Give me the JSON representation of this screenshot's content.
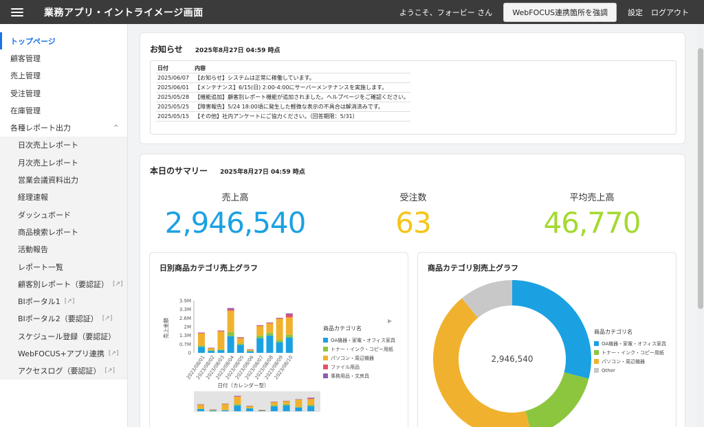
{
  "header": {
    "app_title": "業務アプリ・イントライメージ画面",
    "welcome": "ようこそ、フォービー さん",
    "webfocus_button": "WebFOCUS連携箇所を強調",
    "settings": "設定",
    "logout": "ログアウト"
  },
  "sidebar": {
    "items": [
      {
        "label": "トップページ"
      },
      {
        "label": "顧客管理"
      },
      {
        "label": "売上管理"
      },
      {
        "label": "受注管理"
      },
      {
        "label": "在庫管理"
      },
      {
        "label": "各種レポート出力",
        "chevron": "^"
      }
    ],
    "sub_items": [
      {
        "label": "日次売上レポート"
      },
      {
        "label": "月次売上レポート"
      },
      {
        "label": "営業会議資料出力"
      },
      {
        "label": "経理速報"
      },
      {
        "label": "ダッシュボード"
      },
      {
        "label": "商品検索レポート"
      },
      {
        "label": "活動報告"
      },
      {
        "label": "レポート一覧"
      },
      {
        "label": "顧客別レポート（要認証）",
        "ext": "[↗]"
      },
      {
        "label": "BIポータル1",
        "ext": "[↗]"
      },
      {
        "label": "BIポータル2（要認証）",
        "ext": "[↗]"
      },
      {
        "label": "スケジュール登録（要認証）"
      },
      {
        "label": "WebFOCUS+アプリ連携",
        "ext": "[↗]"
      },
      {
        "label": "アクセスログ（要認証）",
        "ext": "[↗]"
      }
    ]
  },
  "news": {
    "title": "お知らせ",
    "timestamp": "2025年8月27日 04:59 時点",
    "col_date": "日付",
    "col_content": "内容",
    "rows": [
      {
        "date": "2025/06/07",
        "text": "【お知らせ】システムは正常に稼働しています。"
      },
      {
        "date": "2025/06/01",
        "text": "【メンテナンス】6/15(日) 2:00-4:00にサーバーメンテナンスを実施します。"
      },
      {
        "date": "2025/05/28",
        "text": "【機能追加】顧客別レポート機能が追加されました。ヘルプページをご確認ください。"
      },
      {
        "date": "2025/05/25",
        "text": "【障害報告】5/24 18:00頃に発生した軽微な表示の不具合は解消済みです。"
      },
      {
        "date": "2025/05/15",
        "text": "【その他】社内アンケートにご協力ください。（回答期限：5/31）"
      }
    ]
  },
  "summary": {
    "title": "本日のサマリー",
    "timestamp": "2025年8月27日 04:59 時点",
    "kpis": [
      {
        "label": "売上高",
        "value": "2,946,540",
        "color": "#1ba1e2"
      },
      {
        "label": "受注数",
        "value": "63",
        "color": "#f5c518"
      },
      {
        "label": "平均売上高",
        "value": "46,770",
        "color": "#a4d92f"
      }
    ]
  },
  "categories": [
    {
      "name": "OA機器・家電・オフィス家具",
      "color": "#1ba1e2"
    },
    {
      "name": "トナー・インク・コピー用紙",
      "color": "#8cc63f"
    },
    {
      "name": "パソコン・周辺機器",
      "color": "#f0b22e"
    },
    {
      "name": "ファイル用品",
      "color": "#e8506a"
    },
    {
      "name": "事務用品・文房具",
      "color": "#8e5cb5"
    }
  ],
  "chart_data": [
    {
      "type": "bar",
      "title": "日別商品カテゴリ売上グラフ",
      "xlabel": "日付（カレンダー型）",
      "ylabel": "売上金額",
      "legend_title": "商品カテゴリ名",
      "stacked": true,
      "categories": [
        "2023/08/01",
        "2023/08/02",
        "2023/08/03",
        "2023/08/04",
        "2023/08/05",
        "2023/08/06",
        "2023/08/07",
        "2023/08/08",
        "2023/08/09",
        "2023/08/10"
      ],
      "yticks": [
        "0",
        "0.7M",
        "1.3M",
        "2M",
        "2.6M",
        "3.3M",
        "3.9M"
      ],
      "ylim": [
        0,
        3.9
      ],
      "series": [
        {
          "name": "OA機器・家電・オフィス家具",
          "values": [
            0.45,
            0.15,
            0.2,
            1.25,
            0.6,
            0.1,
            1.1,
            1.3,
            0.8,
            1.15
          ]
        },
        {
          "name": "トナー・インク・コピー用紙",
          "values": [
            0.1,
            0.05,
            0.05,
            0.3,
            0.1,
            0.05,
            0.2,
            0.2,
            0.15,
            0.2
          ]
        },
        {
          "name": "パソコン・周辺機器",
          "values": [
            0.9,
            0.15,
            1.35,
            1.6,
            0.4,
            0.1,
            0.7,
            0.7,
            1.6,
            1.3
          ]
        },
        {
          "name": "ファイル用品",
          "values": [
            0.05,
            0.02,
            0.05,
            0.1,
            0.05,
            0.01,
            0.05,
            0.05,
            0.05,
            0.2
          ]
        },
        {
          "name": "事務用品・文房具",
          "values": [
            0.02,
            0.01,
            0.02,
            0.1,
            0.02,
            0.01,
            0.02,
            0.02,
            0.02,
            0.1
          ]
        }
      ]
    },
    {
      "type": "pie",
      "title": "商品カテゴリ別売上グラフ",
      "legend_title": "商品カテゴリ名",
      "center_label": "2,946,540",
      "slices": [
        {
          "name": "OA機器・家電・オフィス家具",
          "value": 0.29,
          "color": "#1ba1e2"
        },
        {
          "name": "トナー・インク・コピー用紙",
          "value": 0.17,
          "color": "#8cc63f"
        },
        {
          "name": "パソコン・周辺機器",
          "value": 0.43,
          "color": "#f0b22e"
        },
        {
          "name": "Other",
          "value": 0.11,
          "color": "#c8c8c8"
        }
      ]
    }
  ]
}
